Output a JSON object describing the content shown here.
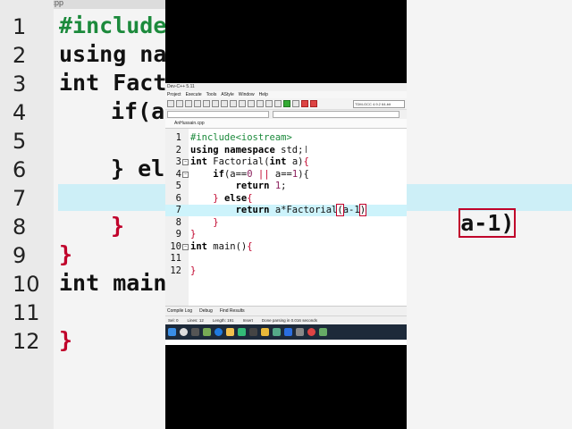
{
  "background": {
    "tab_title": "[*] AnHussain.cpp",
    "line_numbers": [
      "1",
      "2",
      "3",
      "4",
      "5",
      "6",
      "7",
      "8",
      "9",
      "10",
      "11",
      "12"
    ],
    "left_fragments": [
      "#include<",
      "using nam",
      "int Factor",
      "if(a",
      "",
      "} els",
      "",
      "}",
      "}",
      "int main",
      "",
      "}"
    ],
    "right_fragment": "a-1)"
  },
  "ide": {
    "window_title": "Dev-C++ 5.11",
    "menu": [
      "Project",
      "Execute",
      "Tools",
      "AStyle",
      "Window",
      "Help"
    ],
    "compiler": "TDM-GCC 4.9.2 64-bit",
    "file_tab": "AnHussain.cpp",
    "code_lines": [
      {
        "n": "1",
        "fold": false,
        "parts": [
          [
            "pp",
            "#include<iostream>"
          ]
        ]
      },
      {
        "n": "2",
        "fold": false,
        "parts": [
          [
            "kw",
            "using namespace "
          ],
          [
            "",
            "std;"
          ]
        ]
      },
      {
        "n": "3",
        "fold": true,
        "parts": [
          [
            "kw",
            "int "
          ],
          [
            "",
            "Factorial("
          ],
          [
            "kw",
            "int "
          ],
          [
            "",
            "a)"
          ],
          [
            "br",
            "{"
          ]
        ]
      },
      {
        "n": "4",
        "fold": true,
        "parts": [
          [
            "",
            "    "
          ],
          [
            "kw",
            "if"
          ],
          [
            "",
            "(a=="
          ],
          [
            "num",
            "0"
          ],
          [
            "",
            " "
          ],
          [
            "br",
            "||"
          ],
          [
            "",
            " a=="
          ],
          [
            "num",
            "1"
          ],
          [
            "",
            "){"
          ]
        ]
      },
      {
        "n": "5",
        "fold": false,
        "parts": [
          [
            "",
            "        "
          ],
          [
            "kw",
            "return "
          ],
          [
            "num",
            "1"
          ],
          [
            "",
            ";"
          ]
        ]
      },
      {
        "n": "6",
        "fold": false,
        "parts": [
          [
            "",
            "    "
          ],
          [
            "br",
            "}"
          ],
          [
            "",
            " "
          ],
          [
            "kw",
            "else"
          ],
          [
            "br",
            "{"
          ]
        ]
      },
      {
        "n": "7",
        "fold": false,
        "hl": true,
        "parts": [
          [
            "",
            "        "
          ],
          [
            "kw",
            "return "
          ],
          [
            "",
            "a*Factorial"
          ],
          [
            "brbox",
            "("
          ],
          [
            "",
            "a-1"
          ],
          [
            "brbox",
            ")"
          ]
        ]
      },
      {
        "n": "8",
        "fold": false,
        "parts": [
          [
            "",
            "    "
          ],
          [
            "br",
            "}"
          ]
        ]
      },
      {
        "n": "9",
        "fold": false,
        "parts": [
          [
            "br",
            "}"
          ]
        ]
      },
      {
        "n": "10",
        "fold": true,
        "parts": [
          [
            "kw",
            "int "
          ],
          [
            "",
            "main()"
          ],
          [
            "br",
            "{"
          ]
        ]
      },
      {
        "n": "11",
        "fold": false,
        "parts": []
      },
      {
        "n": "12",
        "fold": false,
        "parts": [
          [
            "br",
            "}"
          ]
        ]
      }
    ],
    "bottom_tabs": [
      "Compile Log",
      "Debug",
      "Find Results"
    ],
    "status": {
      "sel_label": "Sel:",
      "sel": "0",
      "lines_label": "Lines:",
      "lines": "12",
      "length_label": "Length:",
      "length": "191",
      "mode": "Insert",
      "message": "Done parsing in 0.016 seconds"
    }
  }
}
